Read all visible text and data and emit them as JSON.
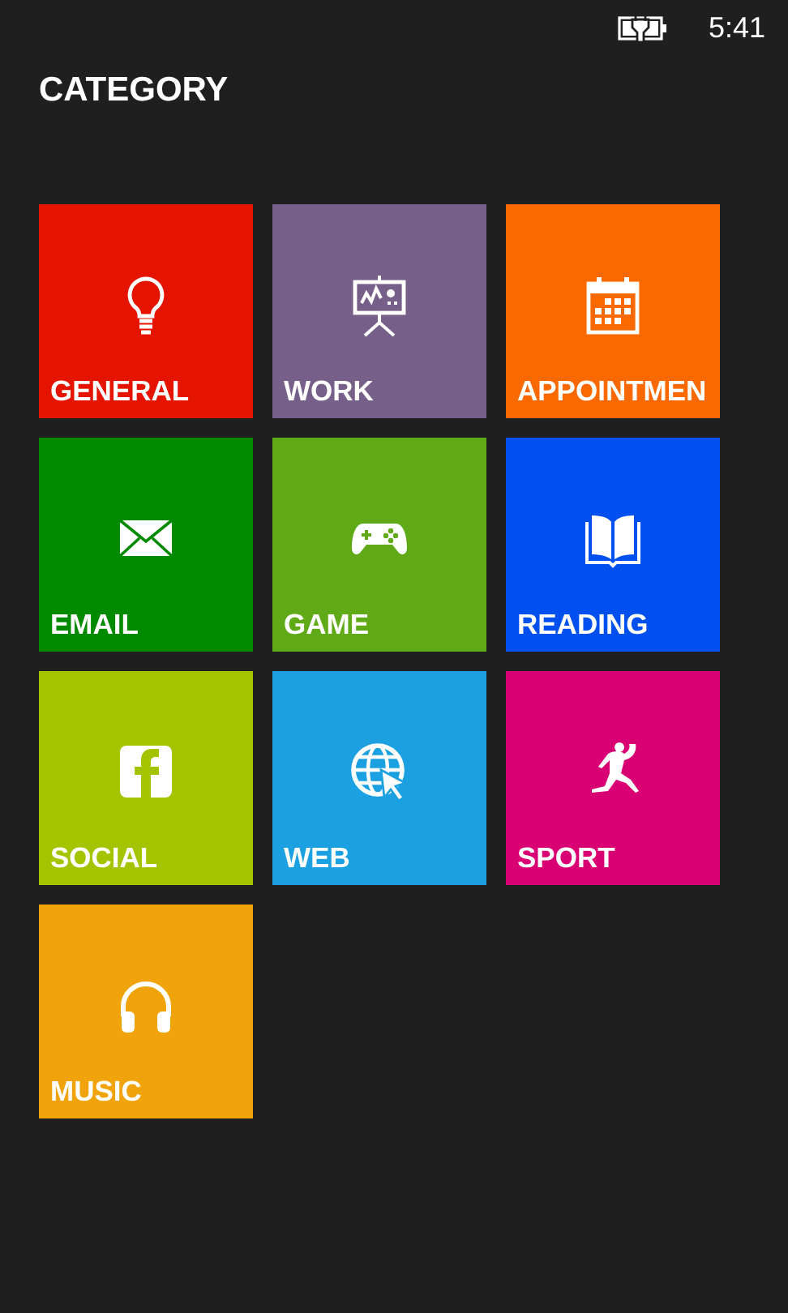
{
  "status_bar": {
    "time": "5:41"
  },
  "title": "CATEGORY",
  "tiles": [
    {
      "label": "GENERAL",
      "color": "#e51400"
    },
    {
      "label": "WORK",
      "color": "#76608a"
    },
    {
      "label": "APPOINTMEN",
      "color": "#fa6800"
    },
    {
      "label": "EMAIL",
      "color": "#008a00"
    },
    {
      "label": "GAME",
      "color": "#60a917"
    },
    {
      "label": "READING",
      "color": "#0050ef"
    },
    {
      "label": "SOCIAL",
      "color": "#a4c400"
    },
    {
      "label": "WEB",
      "color": "#1ba1e2"
    },
    {
      "label": "SPORT",
      "color": "#d80073"
    },
    {
      "label": "MUSIC",
      "color": "#f0a30a"
    }
  ]
}
